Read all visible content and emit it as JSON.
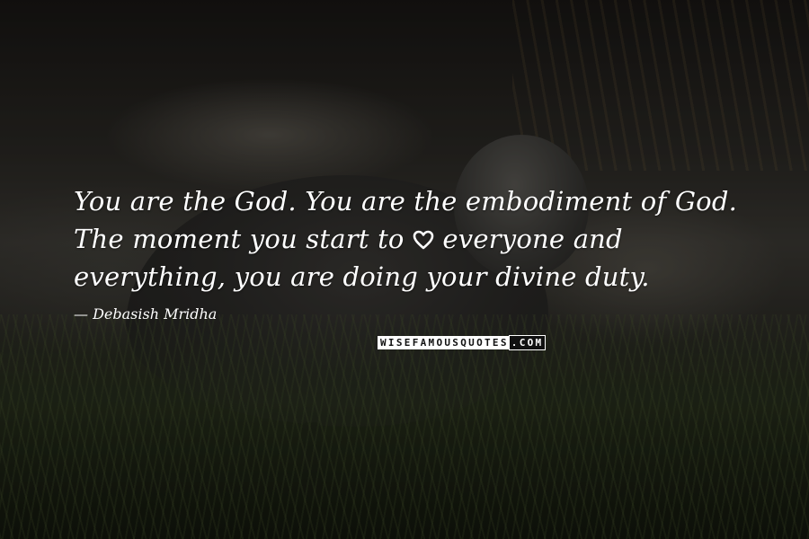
{
  "quote": {
    "before_heart": "You are the God. You are the embodiment of God. The moment you start to ",
    "heart_word": "love",
    "after_heart": " everyone and everything, you are doing your divine duty."
  },
  "author": "Debasish Mridha",
  "watermark": {
    "part1": "WISEFAMOUSQUOTES",
    "part2": ".COM"
  },
  "icons": {
    "heart": "heart-icon"
  }
}
